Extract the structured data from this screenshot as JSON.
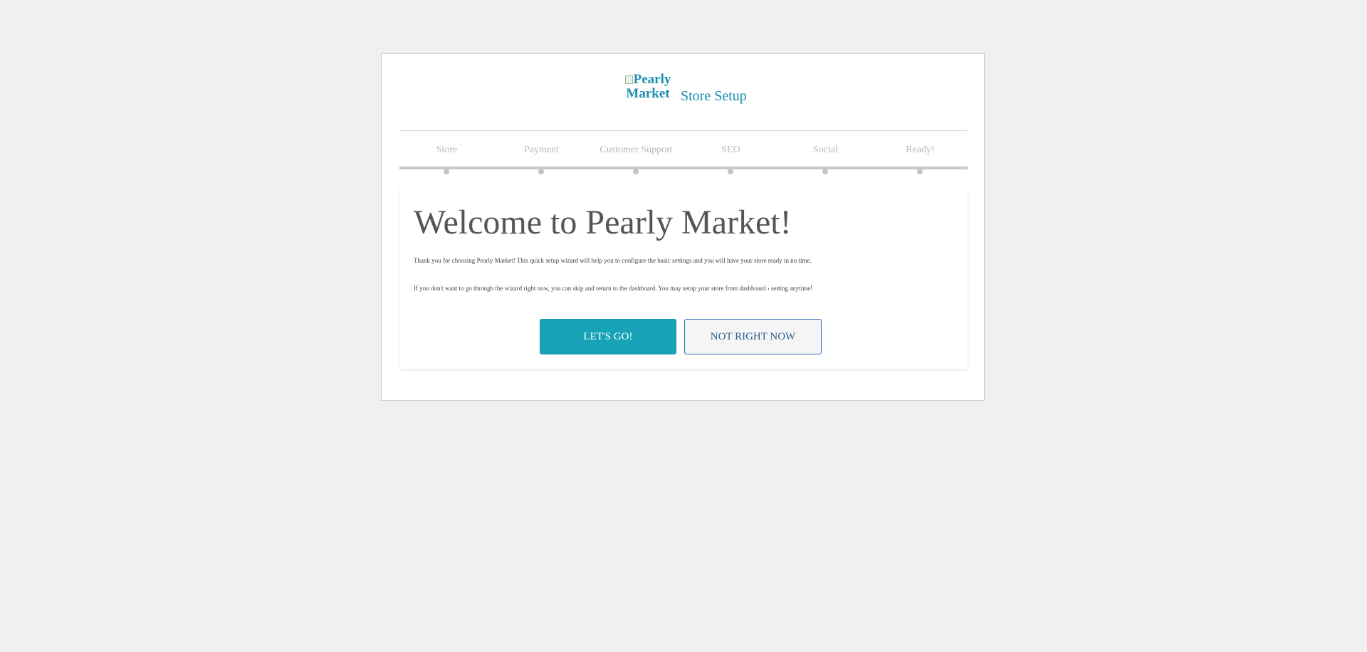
{
  "header": {
    "logo_alt": "Pearly Market",
    "title": "Store Setup"
  },
  "steps": [
    {
      "label": "Store"
    },
    {
      "label": "Payment"
    },
    {
      "label": "Customer Support"
    },
    {
      "label": "SEO"
    },
    {
      "label": "Social"
    },
    {
      "label": "Ready!"
    }
  ],
  "main": {
    "heading": "Welcome to Pearly Market!",
    "paragraph_1": "Thank you for choosing Pearly Market! This quick setup wizard will help you to configure the basic settings and you will have your store ready in no time.",
    "paragraph_2": "If you don't want to go through the wizard right now, you can skip and return to the dashboard. You may setup your store from dashboard › setting anytime!",
    "primary_button": "LET'S GO!",
    "secondary_button": "NOT RIGHT NOW"
  },
  "colors": {
    "accent": "#17a2b8",
    "brand_text": "#1a8fb0",
    "secondary_border": "#2e73b8",
    "background": "#f0f0f0"
  }
}
